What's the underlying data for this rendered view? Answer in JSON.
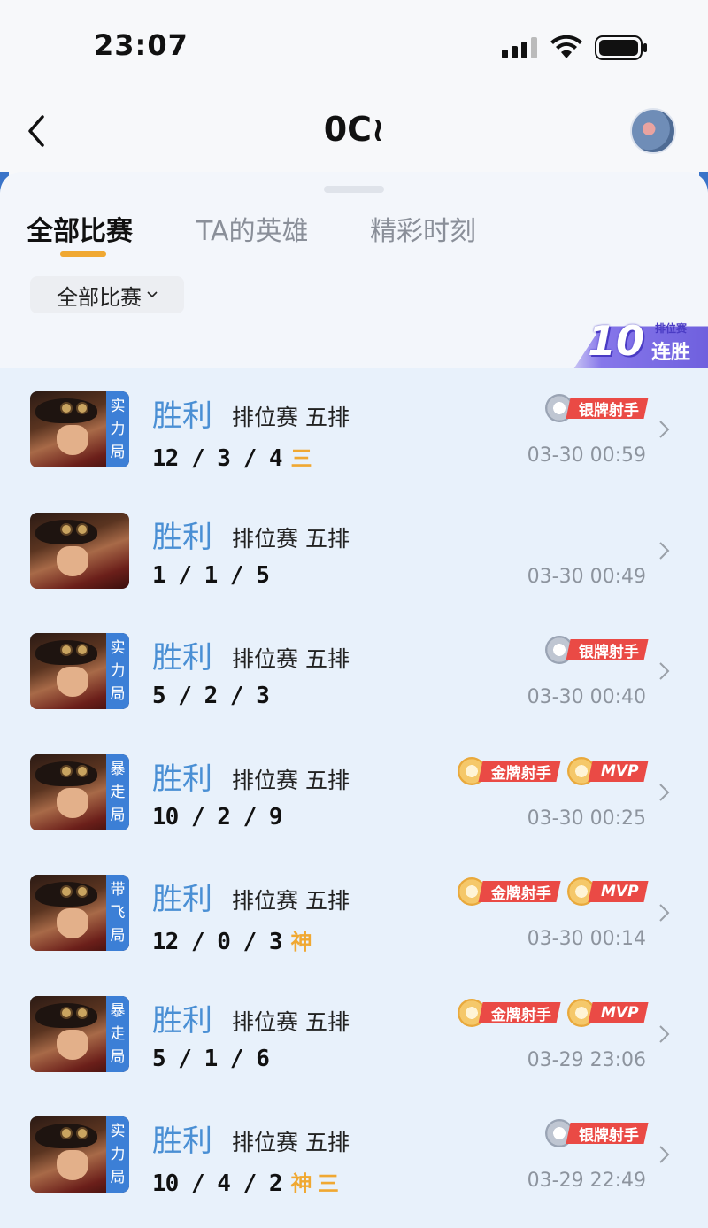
{
  "status": {
    "time": "23:07"
  },
  "nav": {
    "title": "0C≀"
  },
  "tabs": [
    {
      "label": "全部比赛",
      "active": true
    },
    {
      "label": "TA的英雄",
      "active": false
    },
    {
      "label": "精彩时刻",
      "active": false
    }
  ],
  "filter": {
    "label": "全部比赛"
  },
  "streak": {
    "count": "10",
    "type": "排位赛",
    "label": "连胜"
  },
  "colors": {
    "accent": "#f0a832",
    "result": "#4a8fd4",
    "badge_red": "#ea4a45",
    "tag_blue": "#3c7fd6",
    "streak_purple": "#6f60de"
  },
  "matches": [
    {
      "tag": "实力局",
      "result": "胜利",
      "mode": "排位赛 五排",
      "kda": "12 / 3 / 4",
      "extras": "三",
      "badges": [
        {
          "label": "银牌射手",
          "icon": "silver"
        }
      ],
      "time": "03-30 00:59"
    },
    {
      "tag": "",
      "result": "胜利",
      "mode": "排位赛 五排",
      "kda": "1 / 1 / 5",
      "extras": "",
      "badges": [],
      "time": "03-30 00:49"
    },
    {
      "tag": "实力局",
      "result": "胜利",
      "mode": "排位赛 五排",
      "kda": "5 / 2 / 3",
      "extras": "",
      "badges": [
        {
          "label": "银牌射手",
          "icon": "silver"
        }
      ],
      "time": "03-30 00:40"
    },
    {
      "tag": "暴走局",
      "result": "胜利",
      "mode": "排位赛 五排",
      "kda": "10 / 2 / 9",
      "extras": "",
      "badges": [
        {
          "label": "金牌射手",
          "icon": "gold"
        },
        {
          "label": "MVP",
          "icon": "gold"
        }
      ],
      "time": "03-30 00:25"
    },
    {
      "tag": "带飞局",
      "result": "胜利",
      "mode": "排位赛 五排",
      "kda": "12 / 0 / 3",
      "extras": "神",
      "badges": [
        {
          "label": "金牌射手",
          "icon": "gold"
        },
        {
          "label": "MVP",
          "icon": "gold"
        }
      ],
      "time": "03-30 00:14"
    },
    {
      "tag": "暴走局",
      "result": "胜利",
      "mode": "排位赛 五排",
      "kda": "5 / 1 / 6",
      "extras": "",
      "badges": [
        {
          "label": "金牌射手",
          "icon": "gold"
        },
        {
          "label": "MVP",
          "icon": "gold"
        }
      ],
      "time": "03-29 23:06"
    },
    {
      "tag": "实力局",
      "result": "胜利",
      "mode": "排位赛 五排",
      "kda": "10 / 4 / 2",
      "extras": "神 三",
      "badges": [
        {
          "label": "银牌射手",
          "icon": "silver"
        }
      ],
      "time": "03-29 22:49"
    }
  ]
}
